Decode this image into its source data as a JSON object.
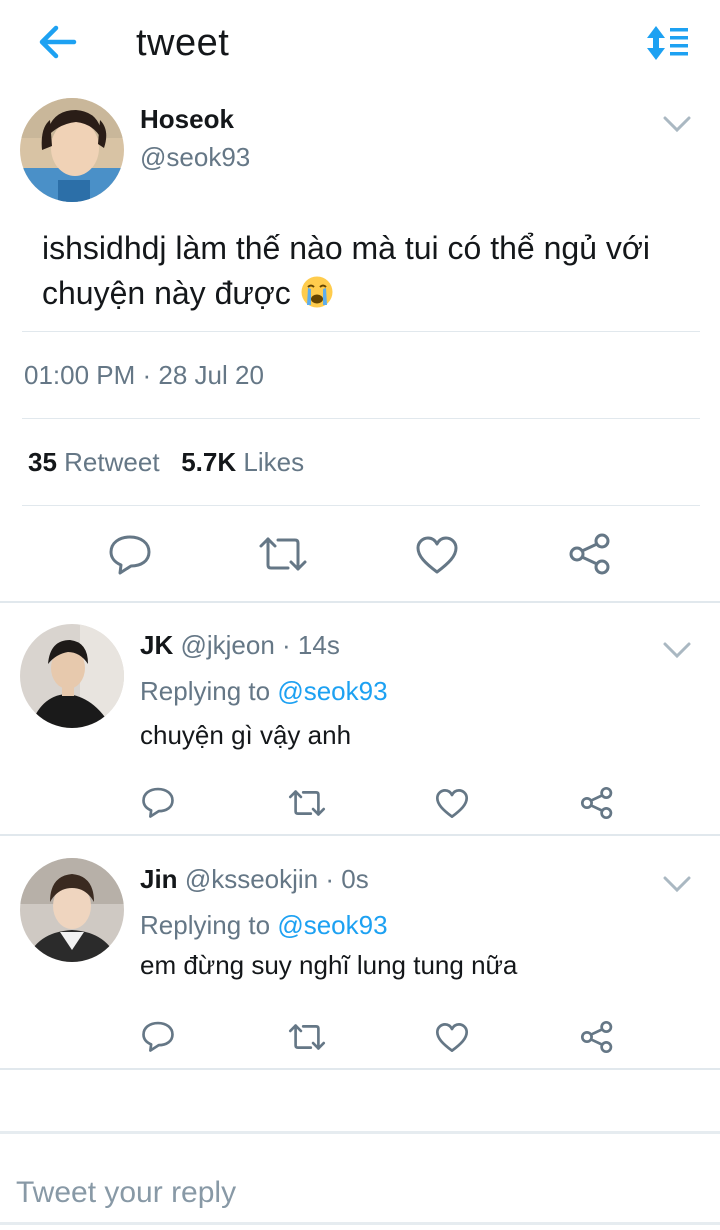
{
  "header": {
    "title": "tweet",
    "back_icon": "back-arrow-icon",
    "sort_icon": "sort-icon",
    "accent": "#1da1f2"
  },
  "main_tweet": {
    "name": "Hoseok",
    "handle": "@seok93",
    "text": "ishsidhdj làm thế nào mà tui có thể ngủ với chuyện này được",
    "emoji": "loudly-crying-face-emoji",
    "timestamp": "01:00 PM · 28 Jul 20",
    "retweet_count": "35",
    "retweet_label": "Retweet",
    "likes_count": "5.7K",
    "likes_label": "Likes"
  },
  "replies": [
    {
      "name": "JK",
      "handle": "@jkjeon",
      "time": "· 14s",
      "replying_label": "Replying to",
      "replying_to": "@seok93",
      "text": "chuyện gì vậy anh"
    },
    {
      "name": "Jin",
      "handle": "@ksseokjin",
      "time": "· 0s",
      "replying_label": "Replying to",
      "replying_to": "@seok93",
      "text": "em đừng suy nghĩ lung tung nữa"
    }
  ],
  "compose": {
    "placeholder": "Tweet your reply"
  },
  "icons": {
    "reply": "reply-icon",
    "retweet": "retweet-icon",
    "like": "like-icon",
    "share": "share-icon",
    "more": "chevron-down-icon"
  },
  "colors": {
    "text": "#14171a",
    "secondary": "#657786",
    "divider": "#e1e8ed",
    "link": "#1da1f2"
  }
}
